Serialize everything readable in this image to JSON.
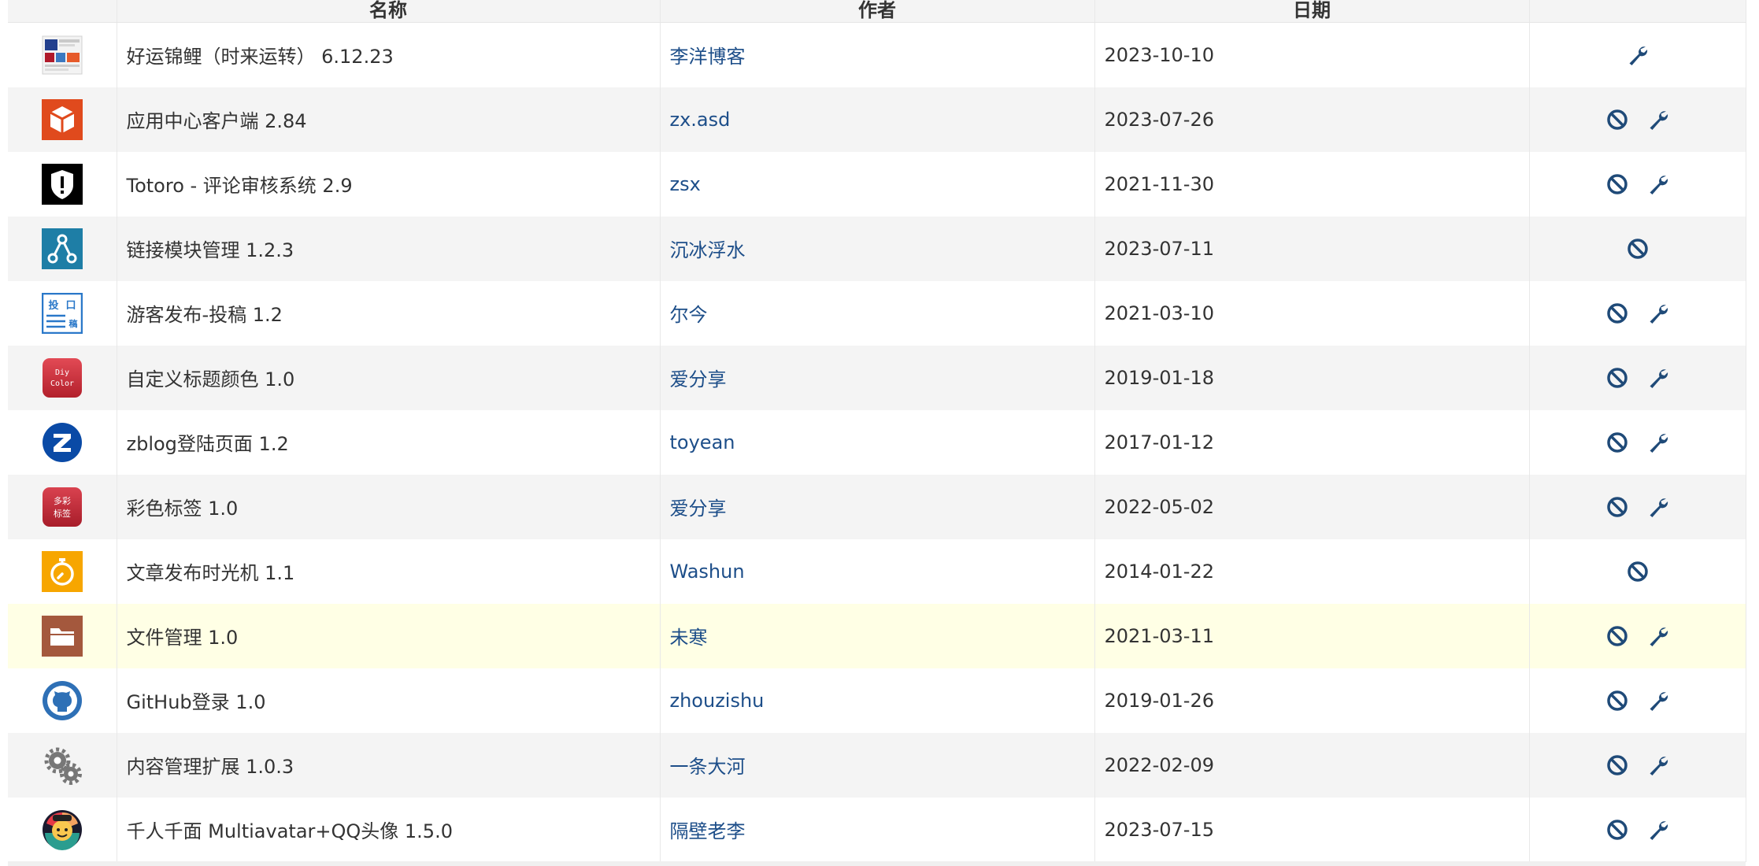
{
  "table": {
    "headers": [
      "",
      "名称",
      "作者",
      "日期",
      ""
    ],
    "rows": [
      {
        "name": "好运锦鲤（时来运转） 6.12.23",
        "author": "李洋博客",
        "date": "2023-10-10",
        "icon": "screenshot-thumbnail-icon",
        "ops": [
          "wrench"
        ]
      },
      {
        "name": "应用中心客户端 2.84",
        "author": "zx.asd",
        "date": "2023-07-26",
        "icon": "app-center-box-icon",
        "ops": [
          "disable",
          "wrench"
        ]
      },
      {
        "name": "Totoro - 评论审核系统 2.9",
        "author": "zsx",
        "date": "2021-11-30",
        "icon": "shield-exclamation-icon",
        "ops": [
          "disable",
          "wrench"
        ]
      },
      {
        "name": "链接模块管理 1.2.3",
        "author": "沉冰浮水",
        "date": "2023-07-11",
        "icon": "link-nodes-icon",
        "ops": [
          "disable"
        ]
      },
      {
        "name": "游客发布-投稿 1.2",
        "author": "尔今",
        "date": "2021-03-10",
        "icon": "submission-form-icon",
        "ops": [
          "disable",
          "wrench"
        ]
      },
      {
        "name": "自定义标题颜色 1.0",
        "author": "爱分享",
        "date": "2019-01-18",
        "icon": "diy-color-icon",
        "ops": [
          "disable",
          "wrench"
        ]
      },
      {
        "name": "zblog登陆页面 1.2",
        "author": "toyean",
        "date": "2017-01-12",
        "icon": "zblog-z-icon",
        "ops": [
          "disable",
          "wrench"
        ]
      },
      {
        "name": "彩色标签 1.0",
        "author": "爱分享",
        "date": "2022-05-02",
        "icon": "color-tag-icon",
        "ops": [
          "disable",
          "wrench"
        ]
      },
      {
        "name": "文章发布时光机 1.1",
        "author": "Washun",
        "date": "2014-01-22",
        "icon": "stopwatch-icon",
        "ops": [
          "disable"
        ]
      },
      {
        "name": "文件管理 1.0",
        "author": "未寒",
        "date": "2021-03-11",
        "icon": "folder-icon",
        "ops": [
          "disable",
          "wrench"
        ],
        "highlight": true
      },
      {
        "name": "GitHub登录 1.0",
        "author": "zhouzishu",
        "date": "2019-01-26",
        "icon": "github-icon",
        "ops": [
          "disable",
          "wrench"
        ]
      },
      {
        "name": "内容管理扩展 1.0.3",
        "author": "一条大河",
        "date": "2022-02-09",
        "icon": "gears-icon",
        "ops": [
          "disable",
          "wrench"
        ]
      },
      {
        "name": "千人千面 Multiavatar+QQ头像 1.5.0",
        "author": "隔壁老李",
        "date": "2023-07-15",
        "icon": "avatar-face-icon",
        "ops": [
          "disable",
          "wrench"
        ]
      }
    ]
  },
  "icon_text": {
    "submission_top": "投",
    "submission_box": "口",
    "submission_sub": "稿",
    "diy_line1": "Diy",
    "diy_line2": "Color",
    "tag_line1": "多彩",
    "tag_line2": "标签"
  },
  "colors": {
    "link": "#1d4e89",
    "op_icon": "#1f4a78",
    "header_bg": "#f4f4f4",
    "row_alt": "#f4f4f4",
    "row_highlight": "#ffffe5"
  }
}
